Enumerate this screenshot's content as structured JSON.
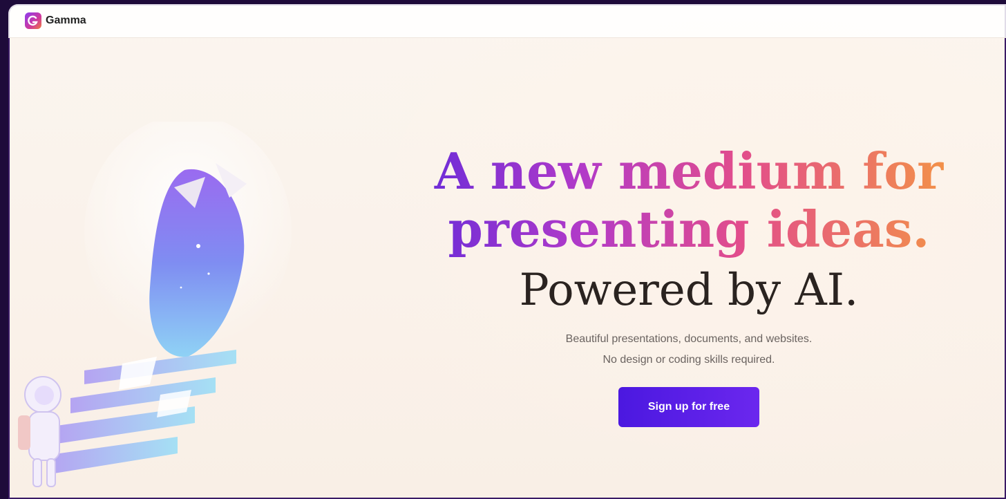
{
  "app": {
    "name": "Gamma"
  },
  "hero": {
    "headline_line1": "A new medium for",
    "headline_line2": "presenting ideas.",
    "powered": "Powered by AI.",
    "sub_line1": "Beautiful presentations, documents, and websites.",
    "sub_line2": "No design or coding skills required."
  },
  "cta": {
    "label": "Sign up for free"
  },
  "colors": {
    "outer_bg": "#1e0b3a",
    "cta": "#5a1ee8",
    "gradient_start": "#6b2cd8",
    "gradient_end": "#f39446"
  },
  "icons": {
    "logo": "gamma-logo-icon"
  }
}
